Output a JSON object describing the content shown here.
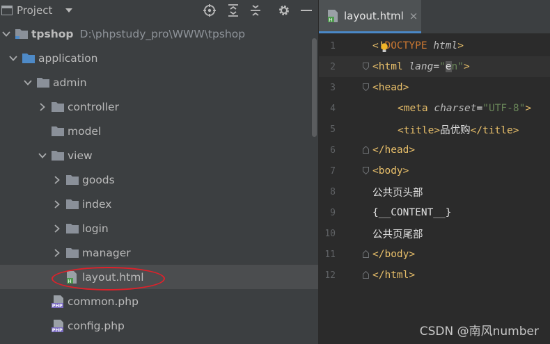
{
  "panel": {
    "title": "Project",
    "toolbar_icons": [
      "crosshair-icon",
      "expand-all-icon",
      "collapse-all-icon",
      "gear-icon",
      "minimize-icon"
    ]
  },
  "tree": {
    "root": {
      "name": "tpshop",
      "path": "D:\\phpstudy_pro\\WWW\\tpshop"
    },
    "items": [
      {
        "label": "application",
        "type": "folder",
        "expanded": true
      },
      {
        "label": "admin",
        "type": "folder",
        "expanded": true
      },
      {
        "label": "controller",
        "type": "folder",
        "expanded": false
      },
      {
        "label": "model",
        "type": "folder",
        "expanded": null
      },
      {
        "label": "view",
        "type": "folder",
        "expanded": true
      },
      {
        "label": "goods",
        "type": "folder",
        "expanded": false
      },
      {
        "label": "index",
        "type": "folder",
        "expanded": false
      },
      {
        "label": "login",
        "type": "folder",
        "expanded": false
      },
      {
        "label": "manager",
        "type": "folder",
        "expanded": false
      },
      {
        "label": "layout.html",
        "type": "html",
        "selected": true
      },
      {
        "label": "common.php",
        "type": "php"
      },
      {
        "label": "config.php",
        "type": "php"
      }
    ]
  },
  "editor": {
    "tab_label": "layout.html",
    "tab_close": "×",
    "current_line": 2,
    "lines": [
      {
        "n": "1",
        "p": [
          "<!",
          "DOCTYPE ",
          "html",
          ">"
        ]
      },
      {
        "n": "2",
        "p": [
          "<",
          "html ",
          "lang",
          "=",
          "\"",
          "e",
          "n",
          "\"",
          ">"
        ]
      },
      {
        "n": "3",
        "p": [
          "<",
          "head",
          ">"
        ]
      },
      {
        "n": "4",
        "p": [
          "<",
          "meta ",
          "charset",
          "=",
          "\"UTF-8\"",
          ">"
        ]
      },
      {
        "n": "5",
        "p": [
          "<",
          "title",
          ">",
          "品优购",
          "</",
          "title",
          ">"
        ]
      },
      {
        "n": "6",
        "p": [
          "</",
          "head",
          ">"
        ]
      },
      {
        "n": "7",
        "p": [
          "<",
          "body",
          ">"
        ]
      },
      {
        "n": "8",
        "p": [
          "公共页头部"
        ]
      },
      {
        "n": "9",
        "p": [
          "{__CONTENT__}"
        ]
      },
      {
        "n": "10",
        "p": [
          "公共页尾部"
        ]
      },
      {
        "n": "11",
        "p": [
          "</",
          "body",
          ">"
        ]
      },
      {
        "n": "12",
        "p": [
          "</",
          "html",
          ">"
        ]
      }
    ]
  },
  "colors": {
    "panel_bg": "#3c3f41",
    "editor_bg": "#2b2b2b",
    "tag": "#e8bf6a",
    "string": "#6a8759",
    "annotation": "#e0212a"
  },
  "watermark": "CSDN @南风number"
}
